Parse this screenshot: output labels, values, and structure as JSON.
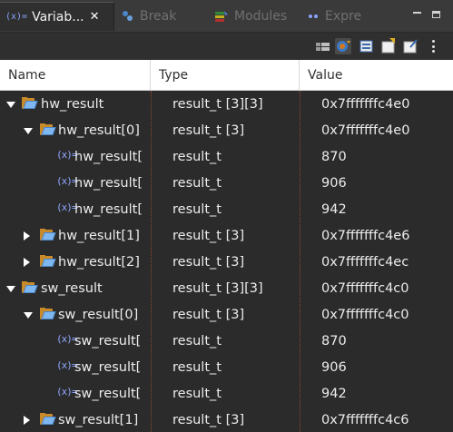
{
  "tabs": [
    {
      "label": "Variab...",
      "icon": "variables-icon",
      "active": true
    },
    {
      "label": "Break",
      "icon": "breakpoints-icon",
      "active": false
    },
    {
      "label": "Modules",
      "icon": "modules-icon",
      "active": false
    },
    {
      "label": "Expre",
      "icon": "expressions-icon",
      "active": false
    }
  ],
  "tab_close_glyph": "✕",
  "window": {
    "minimize_icon": "minimize-icon",
    "maximize_icon": "maximize-icon"
  },
  "toolbar": {
    "buttons": [
      "show-type-names-icon",
      "show-logical-structure-icon",
      "collapse-all-icon",
      "add-global-variables-icon",
      "remove-global-variables-icon"
    ],
    "menu_icon": "view-menu-icon"
  },
  "columns": {
    "name": "Name",
    "type": "Type",
    "value": "Value"
  },
  "variables": [
    {
      "name": "hw_result",
      "type": "result_t [3][3]",
      "value": "0x7fffffffc4e0",
      "depth": 0,
      "kind": "array",
      "expanded": true
    },
    {
      "name": "hw_result[0]",
      "type": "result_t [3]",
      "value": "0x7fffffffc4e0",
      "depth": 1,
      "kind": "array",
      "expanded": true
    },
    {
      "name": "hw_result[",
      "type": "result_t",
      "value": "870",
      "depth": 2,
      "kind": "leaf"
    },
    {
      "name": "hw_result[",
      "type": "result_t",
      "value": "906",
      "depth": 2,
      "kind": "leaf"
    },
    {
      "name": "hw_result[",
      "type": "result_t",
      "value": "942",
      "depth": 2,
      "kind": "leaf"
    },
    {
      "name": "hw_result[1]",
      "type": "result_t [3]",
      "value": "0x7fffffffc4e6",
      "depth": 1,
      "kind": "array",
      "expanded": false
    },
    {
      "name": "hw_result[2]",
      "type": "result_t [3]",
      "value": "0x7fffffffc4ec",
      "depth": 1,
      "kind": "array",
      "expanded": false
    },
    {
      "name": "sw_result",
      "type": "result_t [3][3]",
      "value": "0x7fffffffc4c0",
      "depth": 0,
      "kind": "array",
      "expanded": true
    },
    {
      "name": "sw_result[0]",
      "type": "result_t [3]",
      "value": "0x7fffffffc4c0",
      "depth": 1,
      "kind": "array",
      "expanded": true
    },
    {
      "name": "sw_result[",
      "type": "result_t",
      "value": "870",
      "depth": 2,
      "kind": "leaf"
    },
    {
      "name": "sw_result[",
      "type": "result_t",
      "value": "906",
      "depth": 2,
      "kind": "leaf"
    },
    {
      "name": "sw_result[",
      "type": "result_t",
      "value": "942",
      "depth": 2,
      "kind": "leaf"
    },
    {
      "name": "sw_result[1]",
      "type": "result_t [3]",
      "value": "0x7fffffffc4c6",
      "depth": 1,
      "kind": "array",
      "expanded": false
    }
  ],
  "leaf_icon_glyph": "(x)=",
  "colors": {
    "background": "#2b2b2b",
    "folder_back": "#c98a2a",
    "folder_front": "#7fb7f0",
    "column_divider": "#8a4a2e"
  }
}
